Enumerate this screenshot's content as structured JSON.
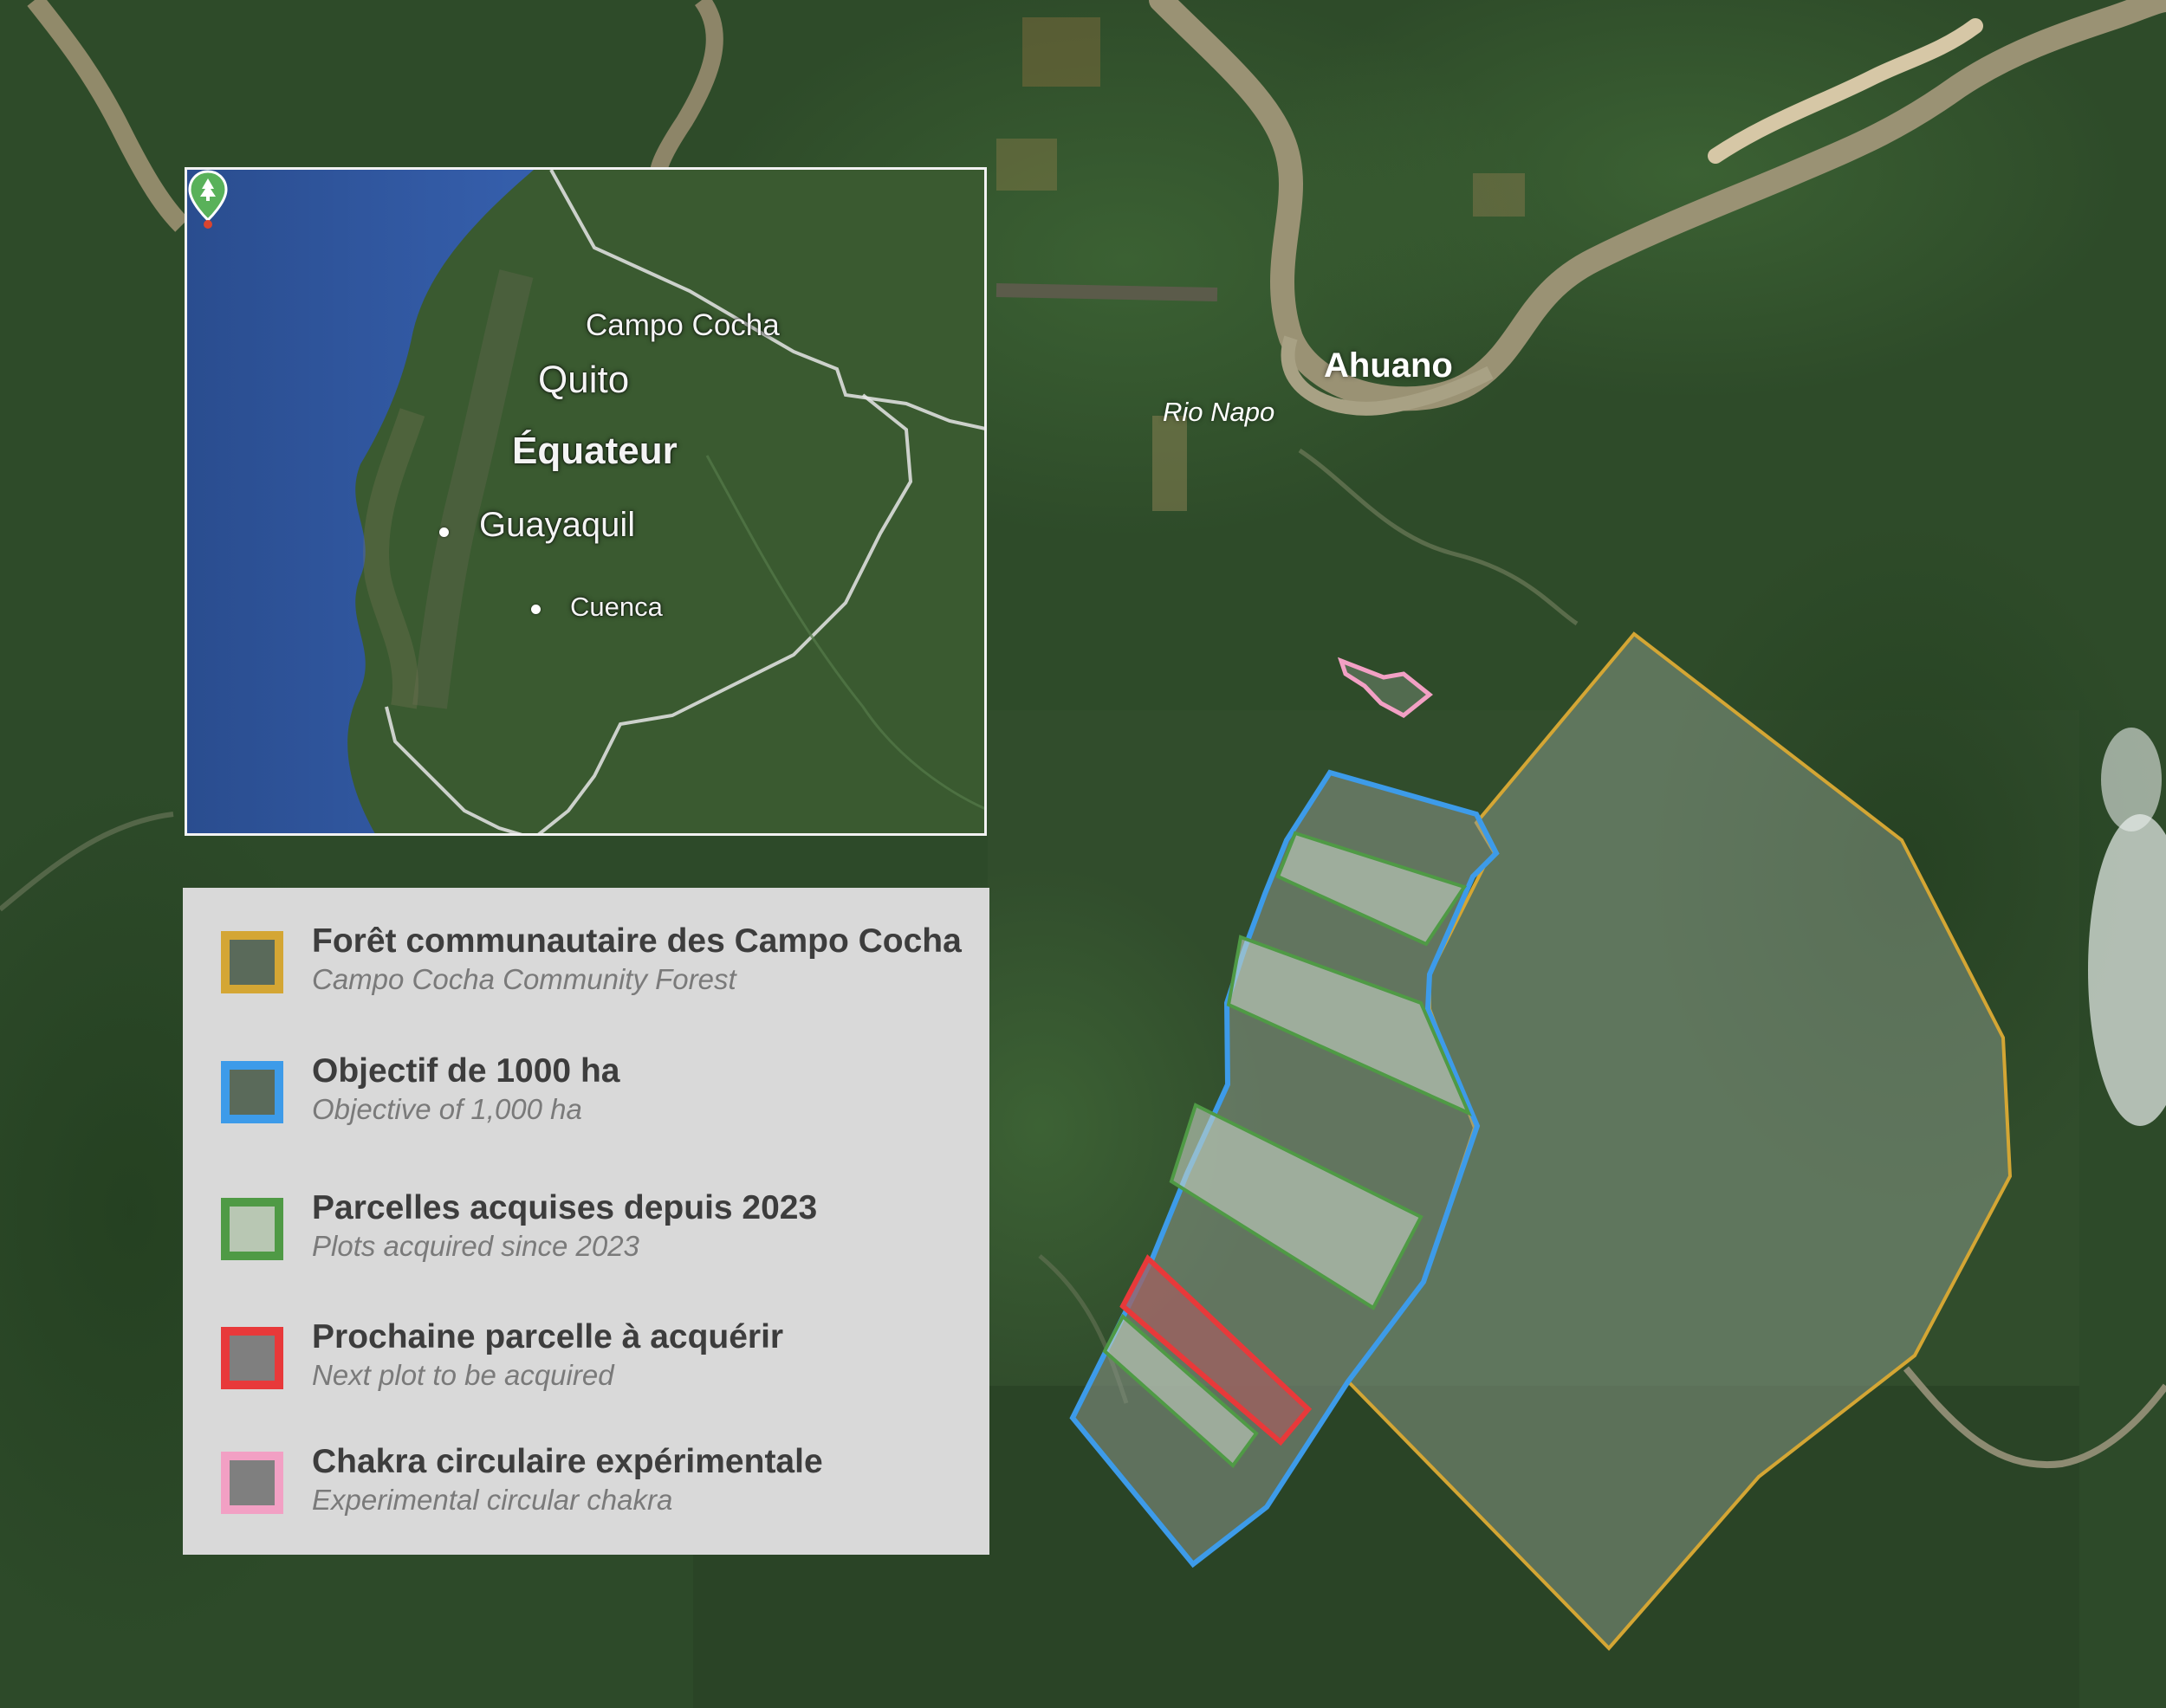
{
  "map": {
    "place_label": "Ahuano",
    "river_label": "Rio Napo"
  },
  "inset": {
    "labels": {
      "campo_cocha": "Campo Cocha",
      "quito": "Quito",
      "country": "Équateur",
      "guayaquil": "Guayaquil",
      "cuenca": "Cuenca"
    },
    "pin_icon": "map-pin-tree-icon"
  },
  "legend": {
    "items": [
      {
        "title": "Forêt communautaire des Campo Cocha",
        "subtitle": "Campo Cocha Community Forest",
        "color": "#d4a634",
        "fill": "#5a6a5a"
      },
      {
        "title": "Objectif de 1000 ha",
        "subtitle": "Objective of 1,000 ha",
        "color": "#3d9be9",
        "fill": "#5a6a5a"
      },
      {
        "title": "Parcelles acquises depuis 2023",
        "subtitle": "Plots acquired since 2023",
        "color": "#4f9a45",
        "fill": "#b8c7b3"
      },
      {
        "title": "Prochaine parcelle à acquérir",
        "subtitle": "Next plot to be acquired",
        "color": "#e8393a",
        "fill": "#7f7f7f"
      },
      {
        "title": "Chakra circulaire expérimentale",
        "subtitle": "Experimental circular chakra",
        "color": "#f2a0c4",
        "fill": "#7f7f7f"
      }
    ]
  }
}
